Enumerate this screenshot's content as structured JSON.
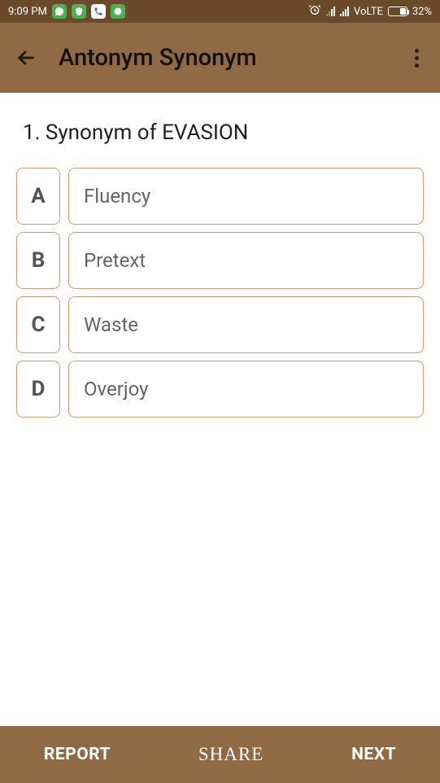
{
  "status_bar": {
    "time": "9:09 PM",
    "volte": "VoLTE",
    "battery_pct": "32%"
  },
  "app_bar": {
    "title": "Antonym Synonym"
  },
  "question": {
    "number": "1",
    "prompt": "1. Synonym of EVASION"
  },
  "options": [
    {
      "letter": "A",
      "text": "Fluency"
    },
    {
      "letter": "B",
      "text": "Pretext"
    },
    {
      "letter": "C",
      "text": "Waste"
    },
    {
      "letter": "D",
      "text": "Overjoy"
    }
  ],
  "bottom_bar": {
    "report": "REPORT",
    "share": "SHARE",
    "next": "NEXT"
  }
}
